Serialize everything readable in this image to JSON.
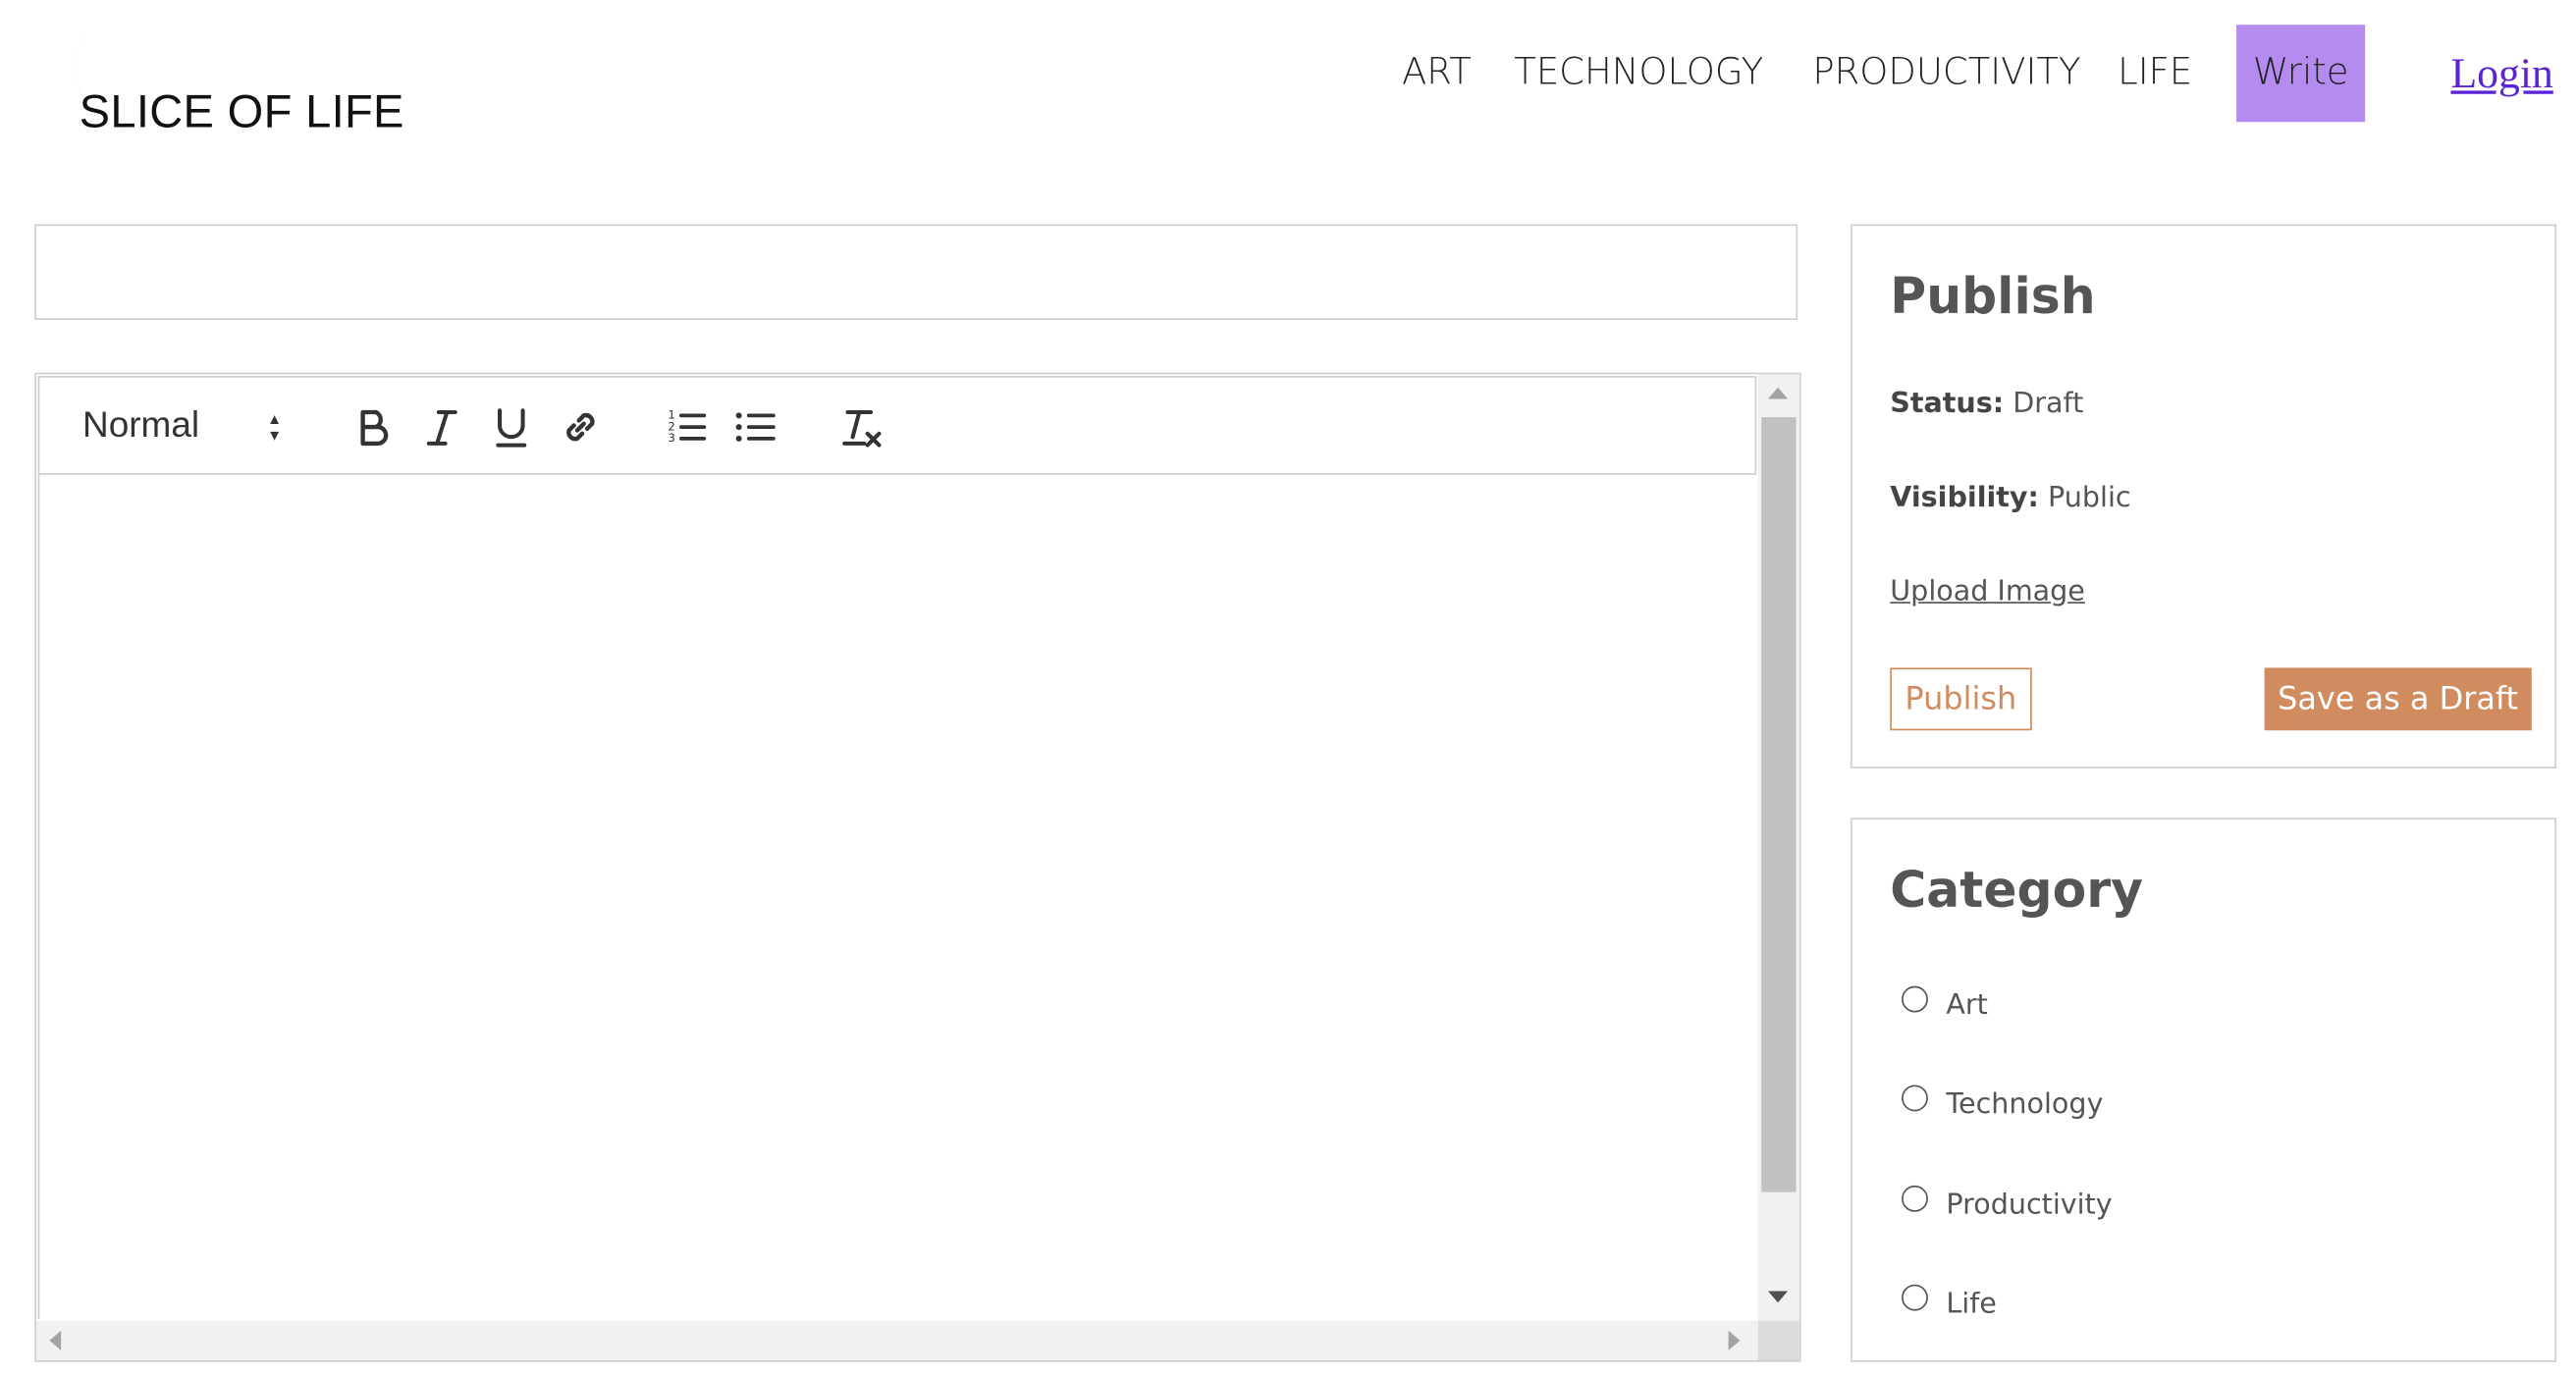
{
  "brand": {
    "name": "SLICE OF LIFE",
    "accent": "#b48cf0"
  },
  "nav": {
    "items": [
      {
        "label": "ART"
      },
      {
        "label": "TECHNOLOGY"
      },
      {
        "label": "PRODUCTIVITY"
      },
      {
        "label": "LIFE"
      }
    ],
    "write_label": "Write",
    "login_label": "Login"
  },
  "editor": {
    "title_value": "",
    "format_value": "Normal",
    "toolbar_icons": [
      "bold-icon",
      "italic-icon",
      "underline-icon",
      "link-icon",
      "ordered-list-icon",
      "bullet-list-icon",
      "clear-format-icon"
    ],
    "content": ""
  },
  "publish": {
    "title": "Publish",
    "status_label": "Status:",
    "status_value": "Draft",
    "visibility_label": "Visibility:",
    "visibility_value": "Public",
    "upload_label": "Upload Image",
    "publish_button": "Publish",
    "draft_button": "Save as a Draft",
    "button_color": "#d08c5e"
  },
  "category": {
    "title": "Category",
    "options": [
      {
        "label": "Art",
        "selected": false
      },
      {
        "label": "Technology",
        "selected": false
      },
      {
        "label": "Productivity",
        "selected": false
      },
      {
        "label": "Life",
        "selected": false
      }
    ]
  }
}
